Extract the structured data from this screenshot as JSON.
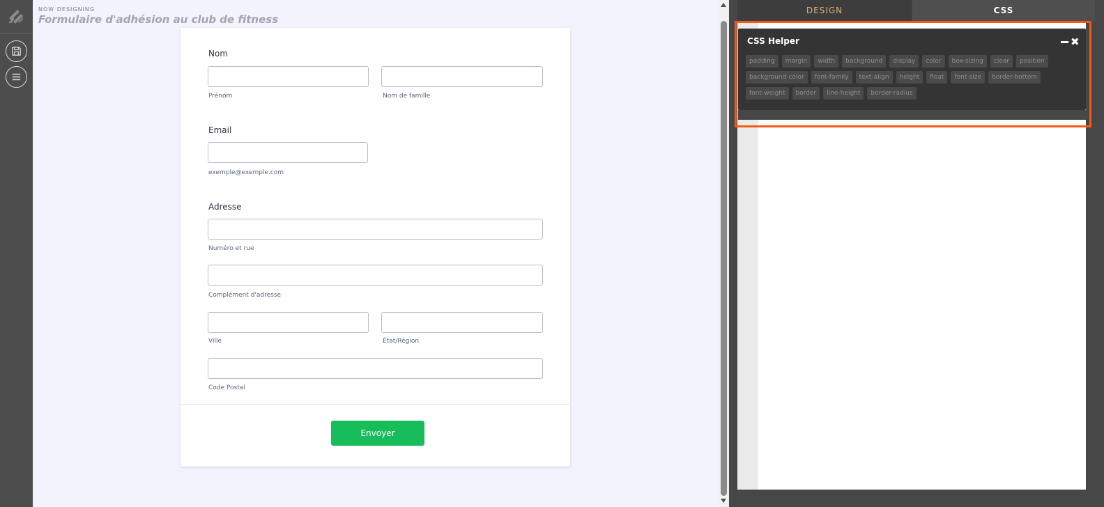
{
  "header": {
    "now_designing": "NOW DESIGNING",
    "form_title": "Formulaire d'adhésion au club de fitness"
  },
  "form": {
    "name_label": "Nom",
    "first_name_sublabel": "Prénom",
    "last_name_sublabel": "Nom de famille",
    "email_label": "Email",
    "email_sublabel": "exemple@exemple.com",
    "address_label": "Adresse",
    "street_sublabel": "Numéro et rue",
    "street2_sublabel": "Complément d'adresse",
    "city_sublabel": "Ville",
    "state_sublabel": "État/Région",
    "zip_sublabel": "Code Postal",
    "submit_label": "Envoyer"
  },
  "panel": {
    "tabs": [
      {
        "label": "DESIGN"
      },
      {
        "label": "CSS"
      }
    ],
    "css_helper": {
      "title": "CSS Helper",
      "close_glyph": "✖",
      "properties": [
        "padding",
        "margin",
        "width",
        "background",
        "display",
        "color",
        "box-sizing",
        "clear",
        "position",
        "background-color",
        "font-family",
        "text-align",
        "height",
        "float",
        "font-size",
        "border-bottom",
        "font-weight",
        "border",
        "line-height",
        "border-radius"
      ]
    }
  },
  "colors": {
    "accent": "#f45a14",
    "submit": "#18bd5b",
    "design_tab": "#d8b27a"
  },
  "icons": {
    "logo": "jotform-logo-icon",
    "save": "save-icon",
    "menu": "menu-icon"
  }
}
